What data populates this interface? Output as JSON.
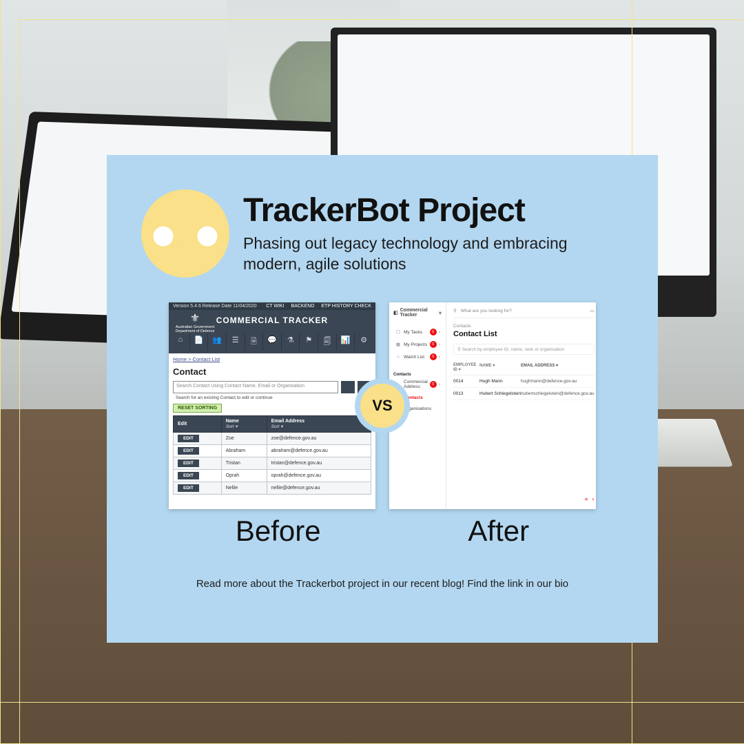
{
  "header": {
    "title": "TrackerBot Project",
    "subtitle": "Phasing out legacy technology and embracing modern, agile solutions"
  },
  "vs_label": "VS",
  "compare_labels": {
    "before": "Before",
    "after": "After"
  },
  "footer_note": "Read more about the Trackerbot project in our recent blog! Find the link in our bio",
  "before": {
    "version_text": "Version 5.4.6 Release Date 11/04/2020",
    "top_links": [
      "CT WIKI",
      "BACKEND",
      "ETP HISTORY CHECK"
    ],
    "gov_line1": "Australian Government",
    "gov_line2": "Department of Defence",
    "app_title": "COMMERCIAL TRACKER",
    "breadcrumb": "Home > Contact List",
    "page_heading": "Contact",
    "search_placeholder": "Search Contact Using Contact Name, Email or Organisation",
    "search_note": "Search for an existing Contact to edit or continue",
    "reset_button": "RESET SORTING",
    "columns": {
      "edit": "Edit",
      "name": "Name",
      "email": "Email Address",
      "sort_hint": "Sort  ▾"
    },
    "edit_label": "EDIT",
    "rows": [
      {
        "name": "Zoe",
        "email": "zoe@defence.gov.au"
      },
      {
        "name": "Abraham",
        "email": "abraham@defence.gov.au"
      },
      {
        "name": "Tristan",
        "email": "tristan@defence.gov.au"
      },
      {
        "name": "Oprah",
        "email": "oprah@defence.gov.au"
      },
      {
        "name": "Nellie",
        "email": "nellie@defence.gov.au"
      }
    ]
  },
  "after": {
    "brand": "Commercial Tracker",
    "top_search_placeholder": "What are you looking for?",
    "nav_primary": [
      {
        "icon": "☐",
        "label": "My Tasks",
        "badge": "0",
        "name": "nav-my-tasks"
      },
      {
        "icon": "▦",
        "label": "My Projects",
        "badge": "0",
        "name": "nav-my-projects"
      },
      {
        "icon": "☆",
        "label": "Watch List",
        "badge": "0",
        "name": "nav-watch-list"
      }
    ],
    "section_label": "Contacts",
    "nav_secondary": [
      {
        "icon": "⌂",
        "label": "Commercial Address",
        "badge": "0",
        "name": "nav-commercial-address"
      },
      {
        "icon": "⚲",
        "label": "Contacts",
        "active": true,
        "name": "nav-contacts"
      },
      {
        "icon": "▤",
        "label": "Organisations",
        "name": "nav-organisations"
      }
    ],
    "breadcrumb": "Contacts",
    "page_heading": "Contact List",
    "filter_placeholder": "Search by employee ID, name, rank or organisation",
    "columns": {
      "id": "EMPLOYEE ID ▾",
      "name": "NAME ▾",
      "email": "EMAIL ADDRESS ▾"
    },
    "rows": [
      {
        "id": "0014",
        "name": "Hugh Mann",
        "email": "hughmann@defence.gov.au"
      },
      {
        "id": "0013",
        "name": "Hubert Schlegelstein",
        "email": "hubertschlegelstein@defence.gov.au"
      }
    ],
    "pager": {
      "first": "«",
      "prev": "‹"
    }
  }
}
